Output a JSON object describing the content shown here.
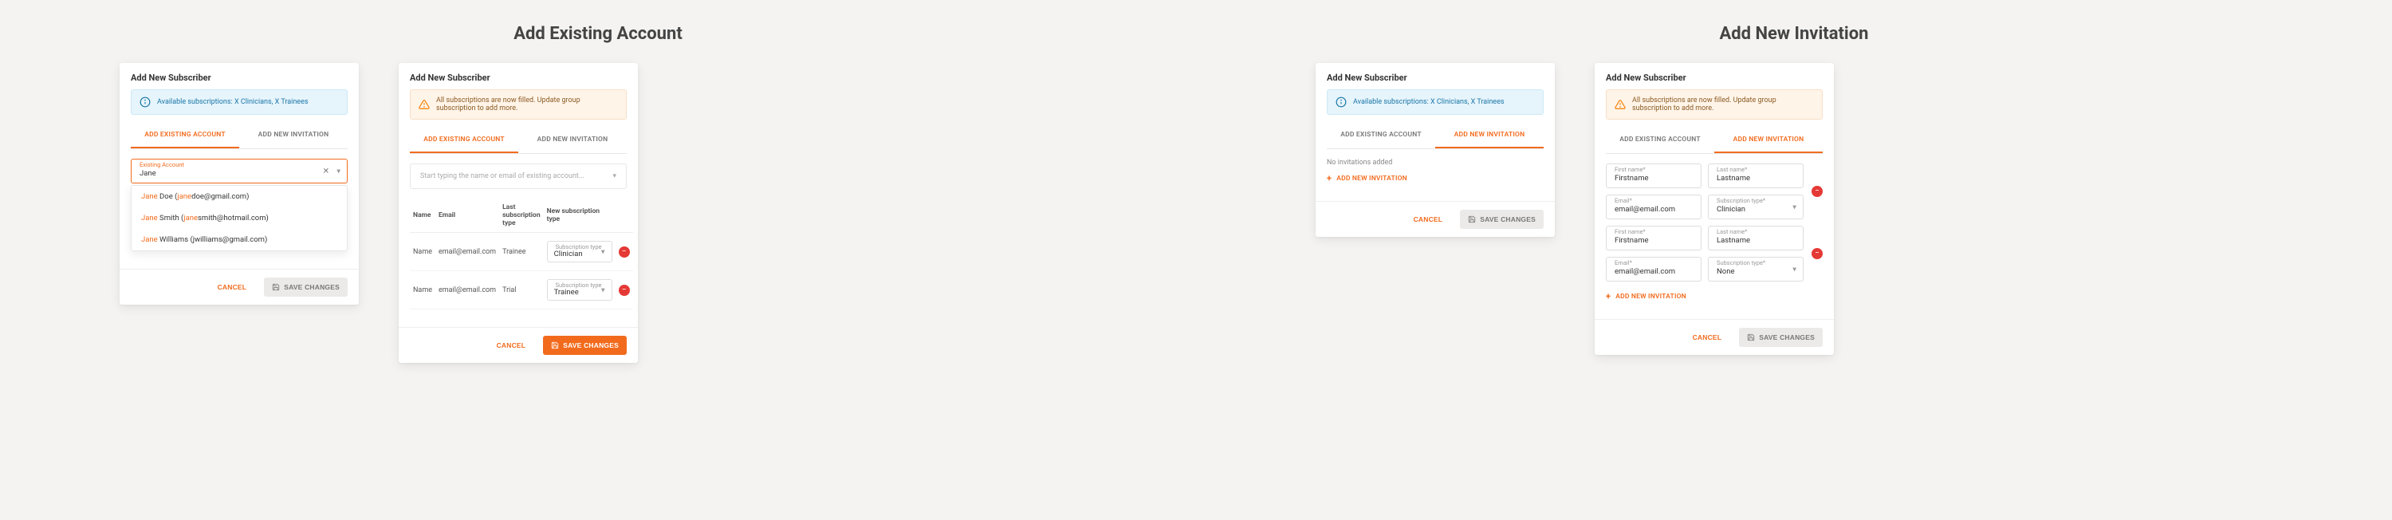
{
  "section_titles": {
    "existing": "Add Existing Account",
    "newinv": "Add New Invitation"
  },
  "modal_title": "Add New Subscriber",
  "tabs": {
    "existing": "ADD EXISTING ACCOUNT",
    "newinv": "ADD NEW INVITATION"
  },
  "alerts": {
    "available": "Available subscriptions: X Clinicians, X Trainees",
    "full": "All subscriptions are now filled. Update group subscription to add more."
  },
  "buttons": {
    "cancel": "CANCEL",
    "save": "SAVE CHANGES",
    "add_invitation": "ADD NEW INVITATION"
  },
  "existing_panel_a": {
    "field_label": "Existing Account",
    "value": "Jane",
    "options": [
      {
        "match": "Jane",
        "rest_name": " Doe (",
        "match_email": "jane",
        "rest_email": "doe@gmail.com)"
      },
      {
        "match": "Jane",
        "rest_name": " Smith (",
        "match_email": "jane",
        "rest_email": "smith@hotmail.com)"
      },
      {
        "match": "Jane",
        "rest_name": " Williams (jwilliams@gmail.com)",
        "match_email": "",
        "rest_email": ""
      }
    ]
  },
  "existing_panel_b": {
    "placeholder": "Start typing the name or email of existing account...",
    "headers": {
      "name": "Name",
      "email": "Email",
      "last": "Last subscription type",
      "newtype": "New subscription type"
    },
    "rows": [
      {
        "name": "Name",
        "email": "email@email.com",
        "last": "Trainee",
        "select_label": "Subscription type",
        "select_value": "Clinician"
      },
      {
        "name": "Name",
        "email": "email@email.com",
        "last": "Trial",
        "select_label": "Subscription type",
        "select_value": "Trainee"
      }
    ]
  },
  "newinv_panel_a": {
    "empty": "No invitations added"
  },
  "newinv_panel_b": {
    "labels": {
      "first": "First name*",
      "last": "Last name*",
      "email": "Email*",
      "subtype": "Subscription type*"
    },
    "rows": [
      {
        "first": "Firstname",
        "last": "Lastname",
        "email": "email@email.com",
        "subtype": "Clinician"
      },
      {
        "first": "Firstname",
        "last": "Lastname",
        "email": "email@email.com",
        "subtype": "None"
      }
    ]
  }
}
